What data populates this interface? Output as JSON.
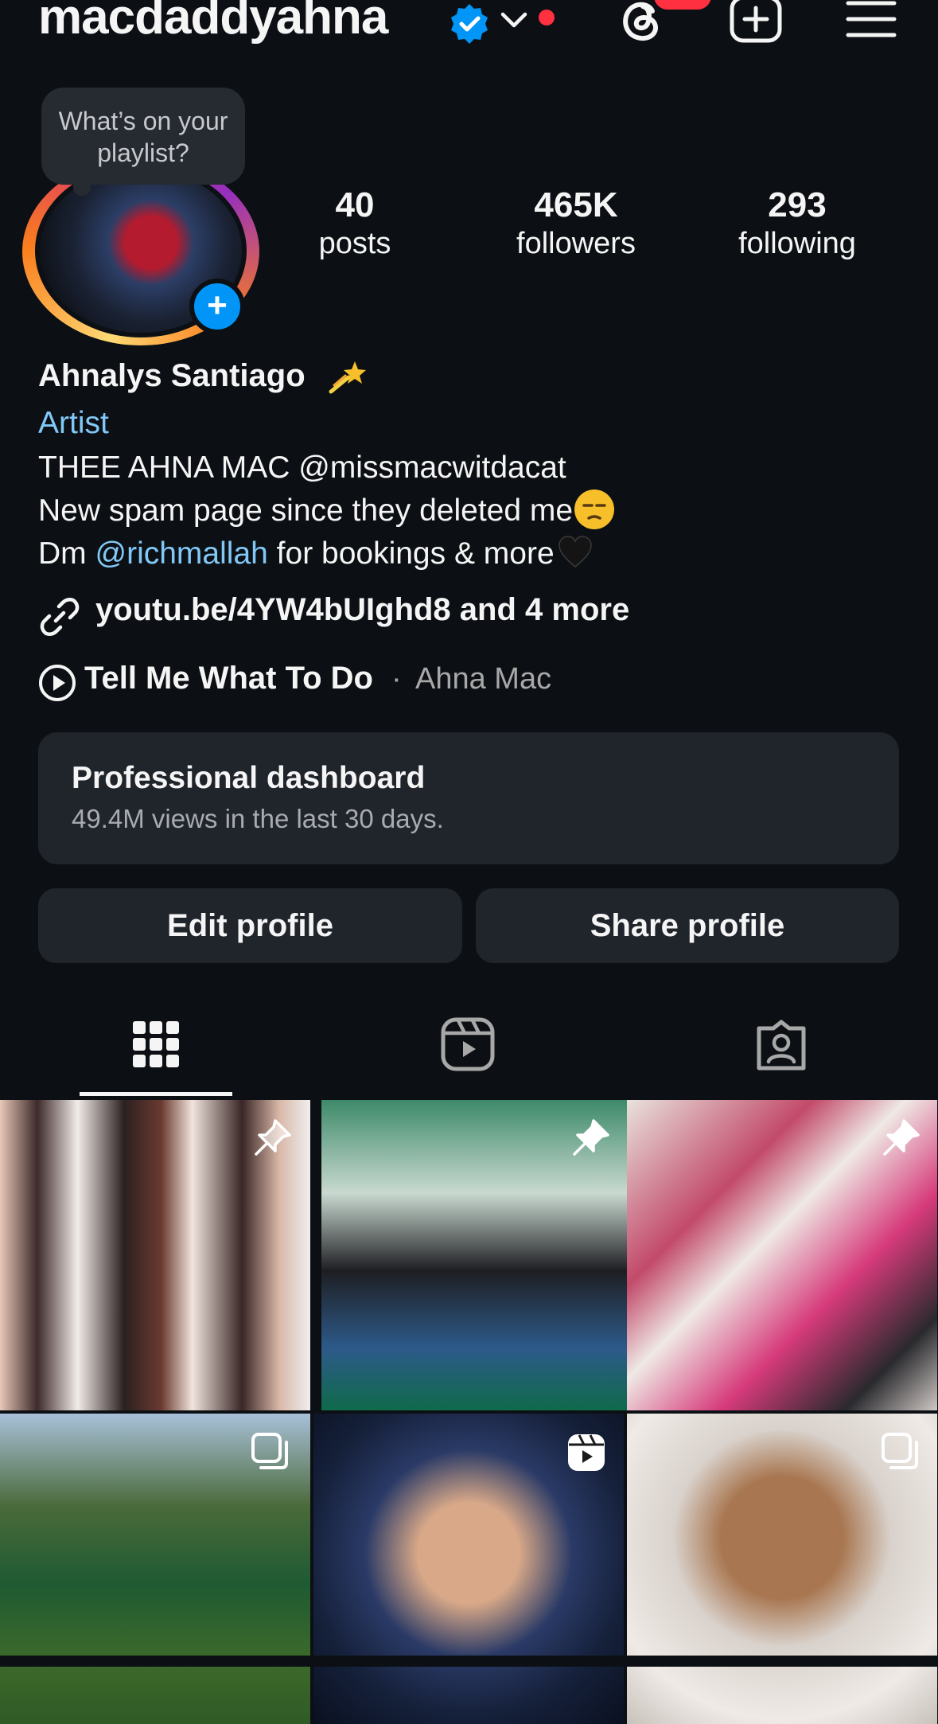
{
  "header": {
    "username": "macdaddyahna"
  },
  "note": {
    "text": "What’s on your playlist?"
  },
  "stats": [
    {
      "value": "40",
      "label": "posts"
    },
    {
      "value": "465K",
      "label": "followers"
    },
    {
      "value": "293",
      "label": "following"
    }
  ],
  "profile": {
    "full_name": "Ahnalys Santiago",
    "category": "Artist",
    "bio_line1": "THEE AHNA MAC @missmacwitdacat",
    "bio_line2": "New spam page since they deleted me",
    "bio_line3_prefix": "Dm ",
    "bio_line3_mention": "@richmallah",
    "bio_line3_suffix": " for bookings & more",
    "link": "youtu.be/4YW4bUIghd8 and 4 more",
    "music_title": "Tell Me What To Do",
    "music_separator": "·",
    "music_artist": "Ahna Mac"
  },
  "dashboard": {
    "title": "Professional dashboard",
    "subtitle": "49.4M views in the last 30 days."
  },
  "buttons": {
    "edit": "Edit profile",
    "share": "Share profile"
  },
  "colors": {
    "background": "#0c1014",
    "accent_blue": "#0095f6",
    "link_blue": "#82c8f7",
    "notification_red": "#ff3040",
    "button_bg": "#20242b"
  },
  "icons": [
    "verified-badge-icon",
    "chevron-down-icon",
    "threads-icon",
    "create-icon",
    "menu-icon",
    "link-icon",
    "play-circle-icon",
    "grid-icon",
    "reels-icon",
    "tagged-icon",
    "pin-icon",
    "carousel-icon"
  ]
}
